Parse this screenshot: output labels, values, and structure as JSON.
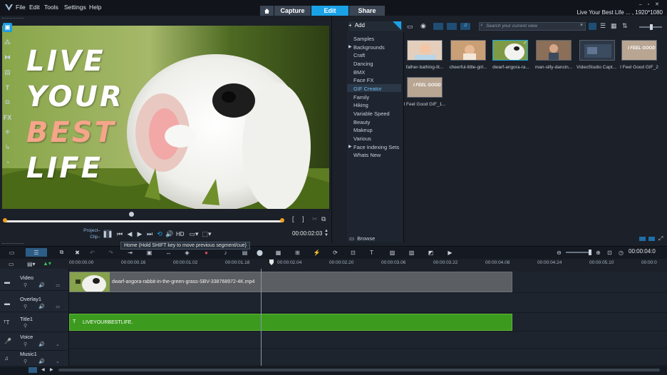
{
  "menu": {
    "items": [
      "File",
      "Edit",
      "Tools",
      "Settings",
      "Help"
    ],
    "window_controls": "– ▫ ✕"
  },
  "workspace_tabs": {
    "capture": "Capture",
    "edit": "Edit",
    "share": "Share"
  },
  "project_title": "Live Your Best Life ... , 1920*1080",
  "preview": {
    "overlay_lines": [
      "LIVE",
      "YOUR",
      "BEST",
      "LIFE"
    ],
    "mode_project": "Project–",
    "mode_clip": "Clip–",
    "hd_label": "HD",
    "timecode": "00:00:02:03",
    "trim_in": "[",
    "trim_out": "]",
    "tooltip": "Home (Hold SHIFT key to move previous segment/cue)"
  },
  "library": {
    "add_label": "Add",
    "search_placeholder": "Search your current view",
    "browse_label": "Browse",
    "selected_folder": "GIF Creator",
    "folders": [
      "Samples",
      "Backgrounds",
      "Craft",
      "Dancing",
      "BMX",
      "Face FX",
      "GIF Creator",
      "Family",
      "Hiking",
      "Variable Speed",
      "Beauty",
      "Makeup",
      "Various",
      "Face Indexing Sets",
      "Whats New"
    ],
    "thumbnails": [
      "father-bathing-lit...",
      "cheerful-little-girl...",
      "dwarf-angora-ra...",
      "man-silly-dancin...",
      "VideoStudio Capt...",
      "I Feel Good GIF_2",
      "I Feel Good GIF_1..."
    ],
    "thumb_overlay_text": "I FEEL GOOD"
  },
  "timeline": {
    "timecode": "00:00:04:0",
    "ruler": [
      "00:00:00.00",
      "00:00:00.16",
      "00:00:01.02",
      "00:00:01.18",
      "00:00:02.04",
      "00:00:02.20",
      "00:00:03.06",
      "00:00:03.22",
      "00:00:04.08",
      "00:00:04.24",
      "00:00:05.10",
      "00:00:0"
    ],
    "tracks": [
      "Video",
      "Overlay1",
      "Title1",
      "Voice",
      "Music1"
    ],
    "video_clip_name": "dwarf-angora-rabbit-in-the-green-grass-SBV-338768972-4K.mp4",
    "title_clip_name": "LIVEYOURBESTLIFE."
  },
  "colors": {
    "accent": "#1aa2e6",
    "title_clip": "#3c9b1e",
    "best_text": "#f5a58a",
    "scrub_marker": "#f2a019"
  }
}
